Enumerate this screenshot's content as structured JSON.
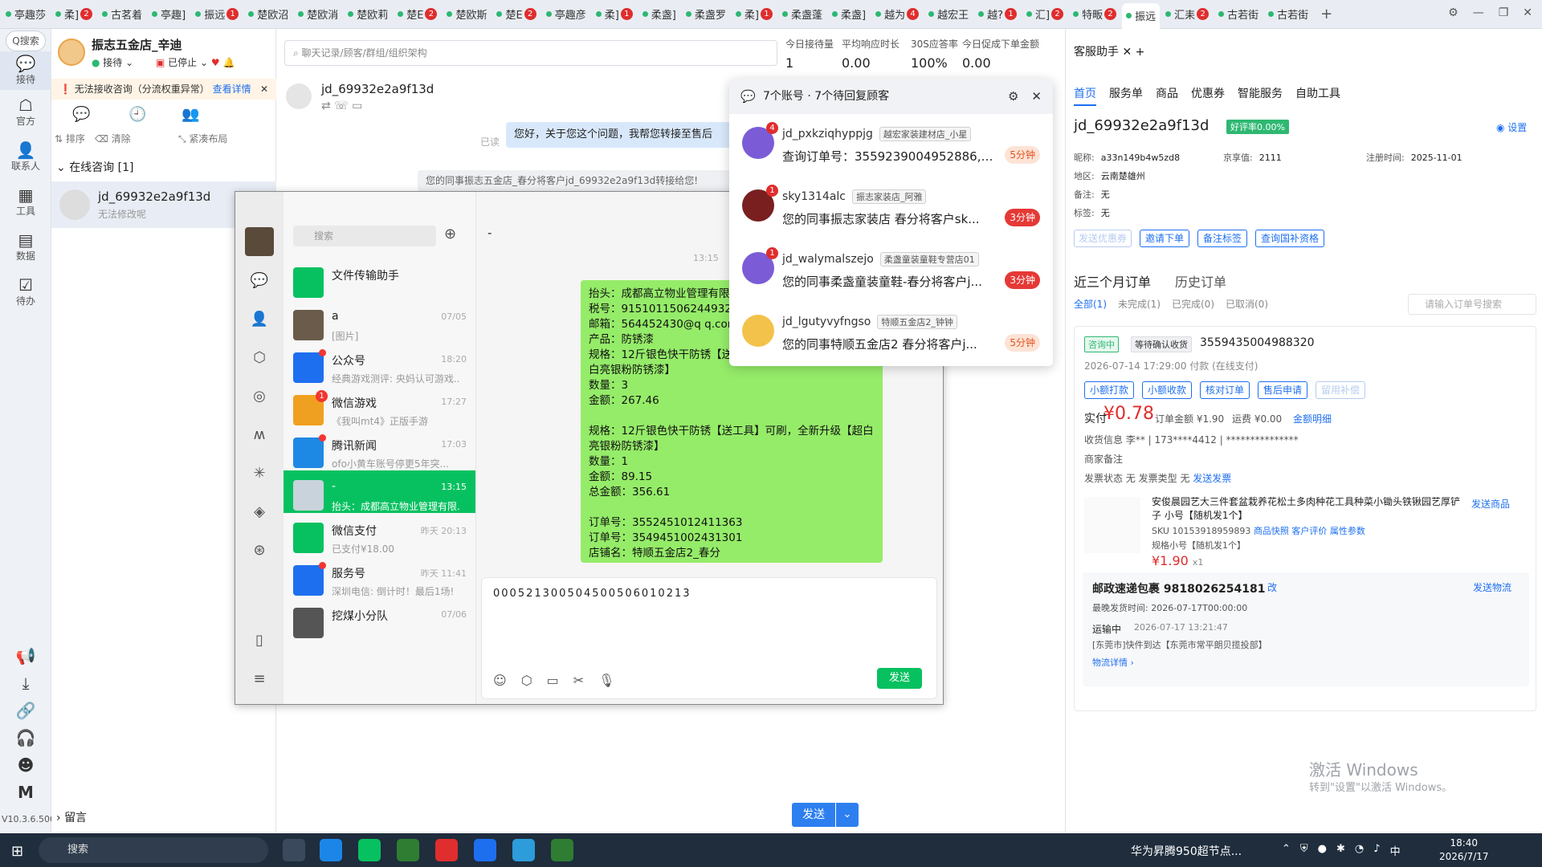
{
  "tabbar": {
    "tabs": [
      {
        "label": "亭趣莎",
        "badge": ""
      },
      {
        "label": "柔]",
        "badge": "2"
      },
      {
        "label": "古茗着",
        "badge": ""
      },
      {
        "label": "亭趣]",
        "badge": ""
      },
      {
        "label": "振远",
        "badge": "1"
      },
      {
        "label": "楚欧沼",
        "badge": ""
      },
      {
        "label": "楚欧消",
        "badge": ""
      },
      {
        "label": "楚欧莉",
        "badge": ""
      },
      {
        "label": "楚E",
        "badge": "2"
      },
      {
        "label": "楚欧斯",
        "badge": ""
      },
      {
        "label": "楚E",
        "badge": "2"
      },
      {
        "label": "亭趣彦",
        "badge": ""
      },
      {
        "label": "柔]",
        "badge": "1"
      },
      {
        "label": "柔盏]",
        "badge": ""
      },
      {
        "label": "柔盏罗",
        "badge": ""
      },
      {
        "label": "柔]",
        "badge": "1"
      },
      {
        "label": "柔盏蓬",
        "badge": ""
      },
      {
        "label": "柔盏]",
        "badge": ""
      },
      {
        "label": "越为",
        "badge": "4"
      },
      {
        "label": "越宏王",
        "badge": ""
      },
      {
        "label": "越?",
        "badge": "1"
      },
      {
        "label": "汇]",
        "badge": "2"
      },
      {
        "label": "特畈",
        "badge": "2"
      },
      {
        "label": "振远",
        "badge": "",
        "active": true
      },
      {
        "label": "汇耒",
        "badge": "2"
      },
      {
        "label": "古若街",
        "badge": ""
      },
      {
        "label": "古若街",
        "badge": ""
      }
    ],
    "plus": "+"
  },
  "rail": {
    "search": "Q搜索",
    "items": [
      {
        "label": "接待",
        "icon": "chat-icon"
      },
      {
        "label": "官方",
        "icon": "official-icon"
      },
      {
        "label": "联系人",
        "icon": "contacts-icon"
      },
      {
        "label": "工具",
        "icon": "tools-icon"
      },
      {
        "label": "数据",
        "icon": "data-icon"
      },
      {
        "label": "待办",
        "icon": "todo-icon"
      }
    ],
    "version": "V10.3.6.500"
  },
  "conv": {
    "shop_name": "振志五金店_辛迪",
    "status_receive": "接待",
    "status_stop": "已停止",
    "warning": "无法接收咨询（分流权重异常）",
    "warning_link": "查看详情",
    "tools": [
      "排序",
      "清除",
      "紧凑布局"
    ],
    "online_header": "在线咨询 [1]",
    "item_name": "jd_69932e2a9f13d",
    "item_sub": "无法修改呢",
    "leave": "留言"
  },
  "chat": {
    "search_placeholder": "聊天记录/顾客/群组/组织架构",
    "stats": [
      {
        "label": "今日接待量",
        "value": "1"
      },
      {
        "label": "平均响应时长",
        "value": "0.00"
      },
      {
        "label": "30S应答率",
        "value": "100%"
      },
      {
        "label": "今日促成下单金额",
        "value": "0.00"
      }
    ],
    "name": "jd_69932e2a9f13d",
    "read": "已读",
    "bubble": "您好，关于您这个问题，我帮您转接至售后",
    "system": "您的同事振志五金店_春分将客户jd_69932e2a9f13d转接给您!",
    "send": "发送"
  },
  "wechat": {
    "search": "搜索",
    "title": "-",
    "time": "13:15",
    "chats": [
      {
        "title": "文件传输助手",
        "sub": "",
        "date": "",
        "color": "#07c160"
      },
      {
        "title": "a",
        "sub": "[图片]",
        "date": "07/05",
        "color": "#6b5b4b"
      },
      {
        "title": "公众号",
        "sub": "经典游戏测评: 央妈认可游戏...",
        "date": "18:20",
        "color": "#1e6ff0",
        "dot": true
      },
      {
        "title": "微信游戏",
        "sub": "《我叫mt4》正版手游",
        "date": "17:27",
        "color": "#f0a020",
        "badge": "1"
      },
      {
        "title": "腾讯新闻",
        "sub": "ofo小黄车账号停更5年突...",
        "date": "17:03",
        "color": "#1e88e5",
        "dot": true
      },
      {
        "title": "-",
        "sub": "抬头：成都高立物业管理有限...",
        "date": "13:15",
        "color": "#c9d3dc",
        "selected": true
      },
      {
        "title": "微信支付",
        "sub": "已支付¥18.00",
        "date": "昨天 20:13",
        "color": "#07c160"
      },
      {
        "title": "服务号",
        "sub": "深圳电信: 倒计时！最后1场!",
        "date": "昨天 11:41",
        "color": "#1e6ff0",
        "dot": true
      },
      {
        "title": "挖煤小分队",
        "sub": "",
        "date": "07/06",
        "color": "#555"
      }
    ],
    "bubble": "抬头：成都高立物业管理有限\n税号：9151011506244932\n邮箱：564452430@q q.com\n产品：防锈漆\n规格：12斤银色快干防锈【送\n白亮银粉防锈漆】\n数量：3\n金额：267.46\n\n规格：12斤银色快干防锈【送工具】可刷，全新升级【超白亮银粉防锈漆】\n数量：1\n金额：89.15\n总金额：356.61\n\n订单号：3552451012411363\n订单号：3549451002431301\n店铺名：特顺五金店2_春分",
    "input": "000521300504500506010213",
    "send": "发送"
  },
  "notif": {
    "title": "7个账号 · 7个待回复顾客",
    "items": [
      {
        "name": "jd_pxkziqhyppjg",
        "tag": "越宏家装建材店_小星",
        "msg": "查询订单号：3559239004952886, ...",
        "time": "5分钟",
        "style": "orange",
        "badge": "4",
        "color": "#7b5cd6"
      },
      {
        "name": "sky1314alc",
        "tag": "振志家装店_阿雅",
        "msg": "您的同事振志家装店 春分将客户sk...",
        "time": "3分钟",
        "style": "red",
        "badge": "1",
        "color": "#7a1f1f"
      },
      {
        "name": "jd_walymalszejo",
        "tag": "柔盏童装童鞋专营店01",
        "msg": "您的同事柔盏童装童鞋-春分将客户j...",
        "time": "3分钟",
        "style": "red",
        "badge": "1",
        "color": "#7b5cd6"
      },
      {
        "name": "jd_lgutyvyfngso",
        "tag": "特顺五金店2_钟钟",
        "msg": "您的同事特顺五金店2 春分将客户j...",
        "time": "5分钟",
        "style": "orange",
        "badge": "",
        "color": "#f3c24a"
      }
    ]
  },
  "assistant": {
    "tab": "客服助手",
    "nav": [
      "首页",
      "服务单",
      "商品",
      "优惠券",
      "智能服务",
      "自助工具"
    ],
    "user": "jd_69932e2a9f13d",
    "good_rate": "好评率0.00%",
    "settings": "设置",
    "nick_label": "昵称:",
    "nick": "a33n149b4w5zd8",
    "jx_label": "京享值:",
    "jx": "2111",
    "reg_label": "注册时间:",
    "reg": "2025-11-01",
    "area_label": "地区:",
    "area": "云南楚雄州",
    "note_label": "备注:",
    "note": "无",
    "tag_label": "标签:",
    "tag": "无",
    "buttons": [
      "发送优惠券",
      "邀请下单",
      "备注标签",
      "查询国补资格"
    ],
    "order_tabs": [
      "近三个月订单",
      "历史订单"
    ],
    "filters": [
      "全部(1)",
      "未完成(1)",
      "已完成(0)",
      "已取消(0)"
    ],
    "order_search": "请输入订单号搜索",
    "order": {
      "status1": "咨询中",
      "status2": "等待确认收货",
      "id": "3559435004988320",
      "time": "2026-07-14 17:29:00  付款  (在线支付)",
      "actions": [
        "小额打款",
        "小额收款",
        "核对订单",
        "售后申请",
        "留用补偿"
      ],
      "paid_label": "实付",
      "paid": "¥0.78",
      "amount": "订单金额 ¥1.90",
      "freight": "运费 ¥0.00",
      "detail_link": "金额明细",
      "receiver": "收货信息  李**  |  173****4412  |  ***************",
      "merchant_note": "商家备注",
      "invoice": "发票状态  无    发票类型  无",
      "invoice_link": "发送发票",
      "product_title": "安俊晨园艺大三件套盆栽养花松土多肉种花工具种菜小锄头铁锹园艺厚铲子 小号【随机发1个】",
      "sku": "SKU 10153918959893",
      "sku_links": "商品快照  客户评价  属性参数",
      "spec": "规格小号【随机发1个】",
      "price": "¥1.90",
      "qty": "x1",
      "send_product": "发送商品",
      "ship_title": "邮政速递包裹 9818026254181",
      "ship_change": "改",
      "ship_send": "发送物流",
      "latest": "最晚发货时间:    2026-07-17T00:00:00",
      "transit": "运输中",
      "transit_time": "2026-07-17 13:21:47",
      "transit_detail": "[东莞市]快件到达【东莞市常平朗贝揽投部】",
      "logistics_link": "物流详情"
    },
    "watermark": "激活 Windows",
    "watermark2": "转到\"设置\"以激活 Windows。"
  },
  "taskbar": {
    "search": "搜索",
    "news": "华为昇腾950超节点...",
    "tray": "中",
    "time": "18:40",
    "date": "2026/7/17"
  }
}
